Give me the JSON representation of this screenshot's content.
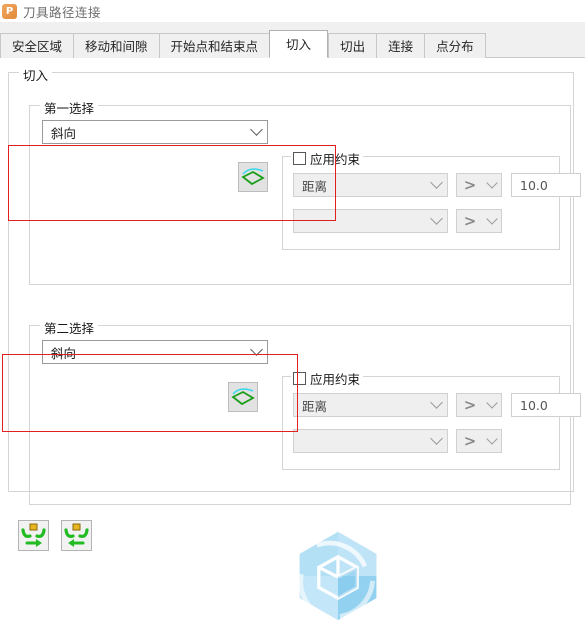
{
  "window": {
    "title": "刀具路径连接",
    "app_icon": "P",
    "icon_color": "#e08a38"
  },
  "tabs": [
    {
      "label": "安全区域",
      "active": false
    },
    {
      "label": "移动和间隙",
      "active": false
    },
    {
      "label": "开始点和结束点",
      "active": false
    },
    {
      "label": "切入",
      "active": true
    },
    {
      "label": "切出",
      "active": false
    },
    {
      "label": "连接",
      "active": false
    },
    {
      "label": "点分布",
      "active": false
    }
  ],
  "cutin_group": {
    "title": "切入"
  },
  "first_choice": {
    "title": "第一选择",
    "combo_value": "斜向",
    "preview_icon": "ramp-lead-in-icon",
    "constraint": {
      "checkbox_label": "应用约束",
      "checked": false,
      "row1": {
        "type_value": "距离",
        "operator": ">",
        "value": "10.0"
      },
      "row2": {
        "type_value": "",
        "operator": ">",
        "value": ""
      }
    }
  },
  "second_choice": {
    "title": "第二选择",
    "combo_value": "斜向",
    "preview_icon": "ramp-lead-in-icon",
    "constraint": {
      "checkbox_label": "应用约束",
      "checked": false,
      "row1": {
        "type_value": "距离",
        "operator": ">",
        "value": "10.0"
      },
      "row2": {
        "type_value": "",
        "operator": ">",
        "value": ""
      }
    }
  },
  "bottom_toolbar": [
    {
      "name": "lead-in-forward-button",
      "direction": "right"
    },
    {
      "name": "lead-in-backward-button",
      "direction": "left"
    }
  ],
  "colors": {
    "annotation": "#e02020",
    "watermark": "#7ec8ef",
    "icon_green": "#22bb22",
    "icon_cyan": "#3fd8ea",
    "icon_gold": "#e8b422"
  }
}
